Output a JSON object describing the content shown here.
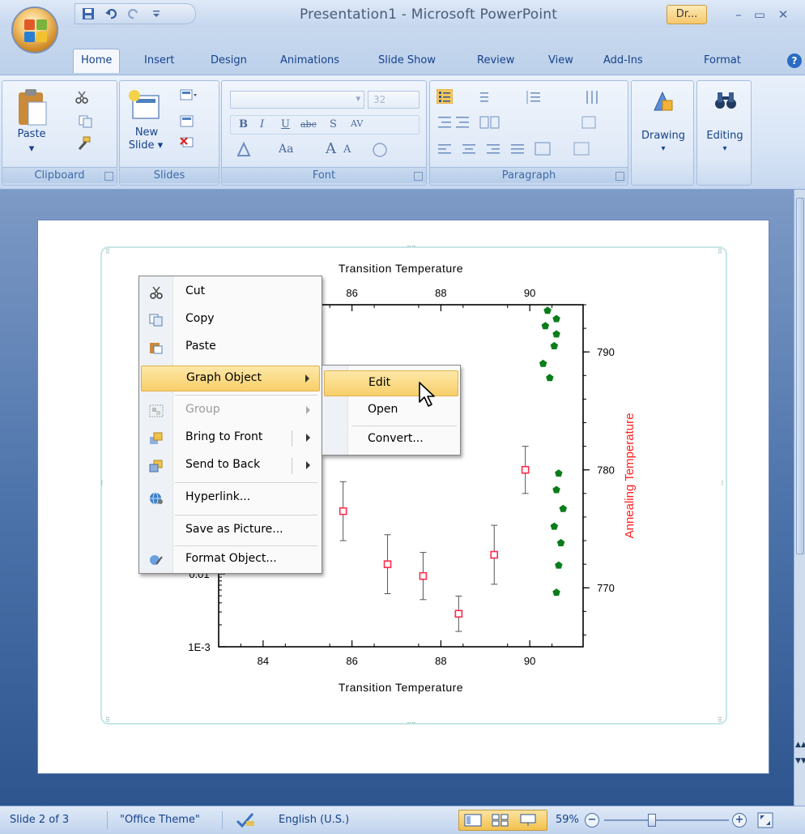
{
  "window": {
    "title": "Presentation1 - Microsoft PowerPoint",
    "contextual_tab_group": "Dr...",
    "controls": {
      "minimize": "–",
      "maximize": "▭",
      "close": "✕"
    }
  },
  "tabs": [
    "Home",
    "Insert",
    "Design",
    "Animations",
    "Slide Show",
    "Review",
    "View",
    "Add-Ins",
    "Format"
  ],
  "ribbon": {
    "clipboard": {
      "label": "Clipboard",
      "paste": "Paste"
    },
    "slides": {
      "label": "Slides",
      "new_slide_1": "New",
      "new_slide_2": "Slide ▾"
    },
    "font": {
      "label": "Font",
      "size": "32",
      "bold": "B",
      "italic": "I",
      "underline": "U",
      "strike": "abc",
      "shadow": "S",
      "spacing": "AV",
      "case": "Aa",
      "grow": "A",
      "shrink": "A"
    },
    "paragraph": {
      "label": "Paragraph"
    },
    "drawing": {
      "label": "Drawing"
    },
    "editing": {
      "label": "Editing"
    }
  },
  "context_menu": {
    "items": [
      {
        "label": "Cut",
        "icon": "scissors-icon",
        "enabled": true
      },
      {
        "label": "Copy",
        "icon": "copy-icon",
        "enabled": true
      },
      {
        "label": "Paste",
        "icon": "paste-icon",
        "enabled": true
      },
      {
        "label": "Graph Object",
        "icon": "",
        "enabled": true,
        "submenu": true,
        "highlighted": true
      },
      {
        "label": "Group",
        "icon": "group-icon",
        "enabled": false,
        "submenu": true
      },
      {
        "label": "Bring to Front",
        "icon": "bring-front-icon",
        "enabled": true,
        "submenu": true
      },
      {
        "label": "Send to Back",
        "icon": "send-back-icon",
        "enabled": true,
        "submenu": true
      },
      {
        "label": "Hyperlink...",
        "icon": "hyperlink-icon",
        "enabled": true
      },
      {
        "label": "Save as Picture...",
        "icon": "",
        "enabled": true
      },
      {
        "label": "Format Object...",
        "icon": "format-object-icon",
        "enabled": true
      }
    ]
  },
  "submenu": {
    "items": [
      {
        "label": "Edit",
        "highlighted": true
      },
      {
        "label": "Open",
        "highlighted": false
      },
      {
        "label": "Convert...",
        "highlighted": false
      }
    ]
  },
  "chart_data": {
    "type": "scatter",
    "title": "Transition Temperature",
    "xlabel": "Transition Temperature",
    "x2label": "Transition Temperature",
    "y2label": "Annealing Temperature",
    "xlim": [
      83,
      91.2
    ],
    "x_ticks": [
      "84",
      "86",
      "88",
      "90"
    ],
    "y_left_scale": "log",
    "y_left_ticks": [
      "1E-3",
      "0.01"
    ],
    "y_right_ticks": [
      "770",
      "780",
      "790"
    ],
    "y2lim": [
      765,
      794
    ],
    "series": [
      {
        "marker": "square-open",
        "color": "#ff2b4a",
        "axis": "left",
        "points": [
          {
            "x": 85.8,
            "y2": 776.5,
            "err": 2.5
          },
          {
            "x": 86.8,
            "y2": 772,
            "err": 2.5
          },
          {
            "x": 87.6,
            "y2": 771,
            "err": 2
          },
          {
            "x": 88.4,
            "y2": 767.8,
            "err": 1.5
          },
          {
            "x": 89.2,
            "y2": 772.8,
            "err": 2.5
          },
          {
            "x": 89.9,
            "y2": 780,
            "err": 2
          }
        ]
      },
      {
        "marker": "pentagon-filled",
        "color": "#0a7d1a",
        "axis": "right",
        "points": [
          {
            "x": 90.4,
            "y2": 793.5
          },
          {
            "x": 90.6,
            "y2": 792.8
          },
          {
            "x": 90.35,
            "y2": 792.2
          },
          {
            "x": 90.6,
            "y2": 791.5
          },
          {
            "x": 90.55,
            "y2": 790.5
          },
          {
            "x": 90.3,
            "y2": 789
          },
          {
            "x": 90.45,
            "y2": 787.8
          },
          {
            "x": 90.65,
            "y2": 779.7
          },
          {
            "x": 90.6,
            "y2": 778.3
          },
          {
            "x": 90.75,
            "y2": 776.7
          },
          {
            "x": 90.55,
            "y2": 775.2
          },
          {
            "x": 90.7,
            "y2": 773.8
          },
          {
            "x": 90.65,
            "y2": 771.9
          },
          {
            "x": 90.6,
            "y2": 769.6
          }
        ]
      }
    ]
  },
  "status": {
    "slide": "Slide 2 of 3",
    "theme": "\"Office Theme\"",
    "language": "English (U.S.)",
    "zoom": "59%",
    "zoom_fraction": 0.38
  }
}
